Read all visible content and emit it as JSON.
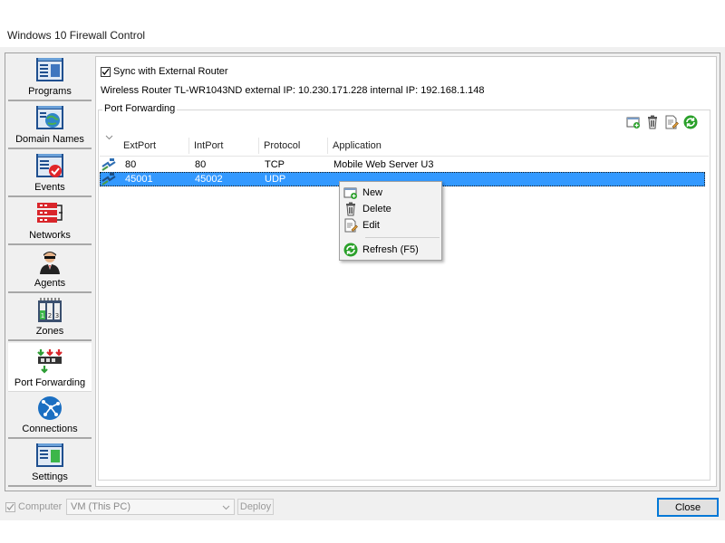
{
  "window": {
    "title": "Windows 10 Firewall Control"
  },
  "sidebar": {
    "items": [
      {
        "label": "Programs",
        "icon": "programs-icon"
      },
      {
        "label": "Domain Names",
        "icon": "domain-names-icon"
      },
      {
        "label": "Events",
        "icon": "events-icon"
      },
      {
        "label": "Networks",
        "icon": "networks-icon"
      },
      {
        "label": "Agents",
        "icon": "agents-icon"
      },
      {
        "label": "Zones",
        "icon": "zones-icon"
      },
      {
        "label": "Port Forwarding",
        "icon": "port-forwarding-icon",
        "active": true
      },
      {
        "label": "Connections",
        "icon": "connections-icon"
      },
      {
        "label": "Settings",
        "icon": "settings-icon"
      }
    ]
  },
  "main": {
    "sync_label": "Sync with External Router",
    "sync_checked": true,
    "router_info": "Wireless Router TL-WR1043ND external IP: 10.230.171.228 internal IP: 192.168.1.148",
    "group_label": "Port Forwarding",
    "toolbar": [
      "new-icon",
      "delete-icon",
      "edit-icon",
      "refresh-icon"
    ],
    "table": {
      "columns": [
        "ExtPort",
        "IntPort",
        "Protocol",
        "Application"
      ],
      "rows": [
        {
          "ext": "80",
          "int": "80",
          "protocol": "TCP",
          "app": "Mobile Web Server U3",
          "selected": false
        },
        {
          "ext": "45001",
          "int": "45002",
          "protocol": "UDP",
          "app": "",
          "selected": true
        }
      ]
    }
  },
  "context_menu": {
    "items": [
      {
        "label": "New",
        "icon": "new-icon"
      },
      {
        "label": "Delete",
        "icon": "delete-icon"
      },
      {
        "label": "Edit",
        "icon": "edit-icon"
      },
      {
        "label": "Refresh (F5)",
        "icon": "refresh-icon"
      }
    ]
  },
  "bottom": {
    "computer_label": "Computer",
    "computer_checked": true,
    "combo_value": "VM (This PC)",
    "deploy_label": "Deploy",
    "close_label": "Close"
  },
  "colors": {
    "selection": "#3399ff",
    "accent": "#0078d7",
    "refresh_green": "#2aa02a"
  }
}
